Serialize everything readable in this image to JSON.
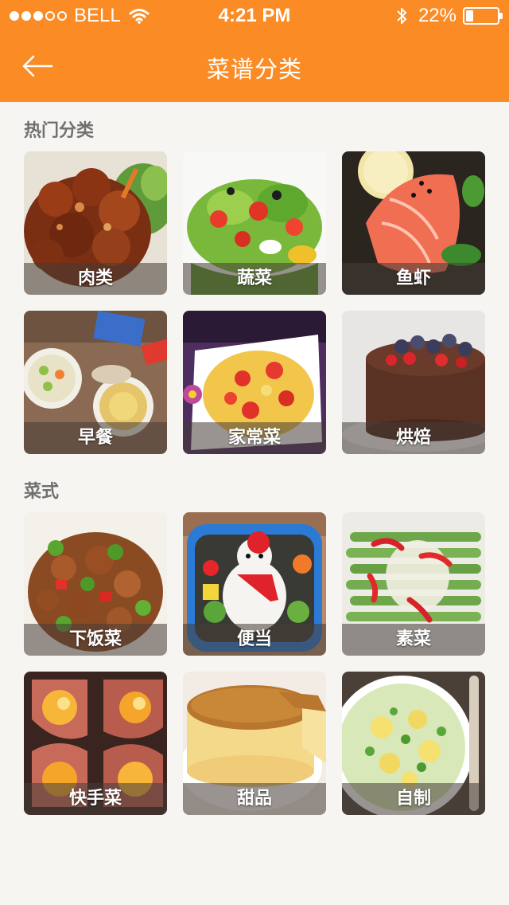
{
  "status_bar": {
    "carrier": "BELL",
    "time": "4:21 PM",
    "battery": "22%",
    "battery_level": 0.22,
    "signal_bars_filled": 3,
    "signal_bars_total": 5
  },
  "nav": {
    "title": "菜谱分类",
    "back_icon": "arrow-left-icon"
  },
  "colors": {
    "accent": "#fb8b25",
    "background": "#f6f5f1",
    "section_title": "#707070"
  },
  "sections": [
    {
      "title": "热门分类",
      "items": [
        {
          "label": "肉类"
        },
        {
          "label": "蔬菜"
        },
        {
          "label": "鱼虾"
        },
        {
          "label": "早餐"
        },
        {
          "label": "家常菜"
        },
        {
          "label": "烘焙"
        }
      ]
    },
    {
      "title": "菜式",
      "items": [
        {
          "label": "下饭菜"
        },
        {
          "label": "便当"
        },
        {
          "label": "素菜"
        },
        {
          "label": "快手菜"
        },
        {
          "label": "甜品"
        },
        {
          "label": "自制"
        }
      ]
    }
  ]
}
